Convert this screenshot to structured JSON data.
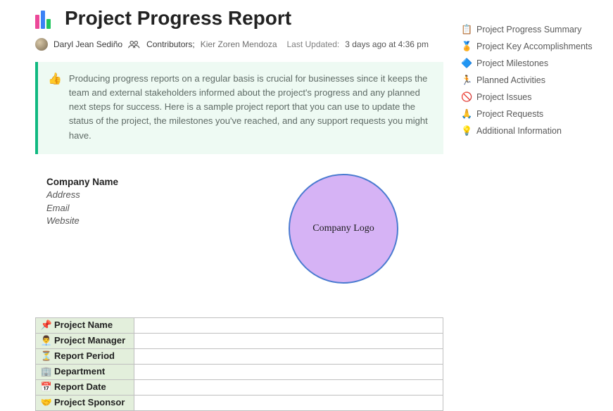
{
  "header": {
    "title": "Project Progress Report",
    "author": "Daryl Jean Sediño",
    "contributors_label": "Contributors;",
    "contributors": "Kier Zoren Mendoza",
    "last_updated_label": "Last Updated:",
    "last_updated_value": "3 days ago at 4:36 pm"
  },
  "callout": {
    "icon": "👍",
    "text": "Producing progress reports on a regular basis is crucial for businesses since it keeps the team and external stakeholders informed about the project's progress and any planned next steps for success. Here is a sample project report that you can use to update the status of the project, the milestones you've reached, and any support requests you might have."
  },
  "company": {
    "name_label": "Company Name",
    "address": "Address",
    "email": "Email",
    "website": "Website",
    "logo_text": "Company Logo"
  },
  "info_rows": [
    {
      "icon": "📌",
      "label": "Project Name",
      "value": ""
    },
    {
      "icon": "👨‍💼",
      "label": "Project Manager",
      "value": ""
    },
    {
      "icon": "⏳",
      "label": "Report Period",
      "value": ""
    },
    {
      "icon": "🏢",
      "label": "Department",
      "value": ""
    },
    {
      "icon": "📅",
      "label": "Report Date",
      "value": ""
    },
    {
      "icon": "🤝",
      "label": "Project Sponsor",
      "value": ""
    }
  ],
  "toc": [
    {
      "icon": "📋",
      "label": "Project Progress Summary"
    },
    {
      "icon": "🏅",
      "label": "Project Key Accomplishments"
    },
    {
      "icon": "🔷",
      "label": "Project Milestones"
    },
    {
      "icon": "🏃",
      "label": "Planned Activities"
    },
    {
      "icon": "🚫",
      "label": "Project Issues"
    },
    {
      "icon": "🙏",
      "label": "Project Requests"
    },
    {
      "icon": "💡",
      "label": "Additional Information"
    }
  ]
}
